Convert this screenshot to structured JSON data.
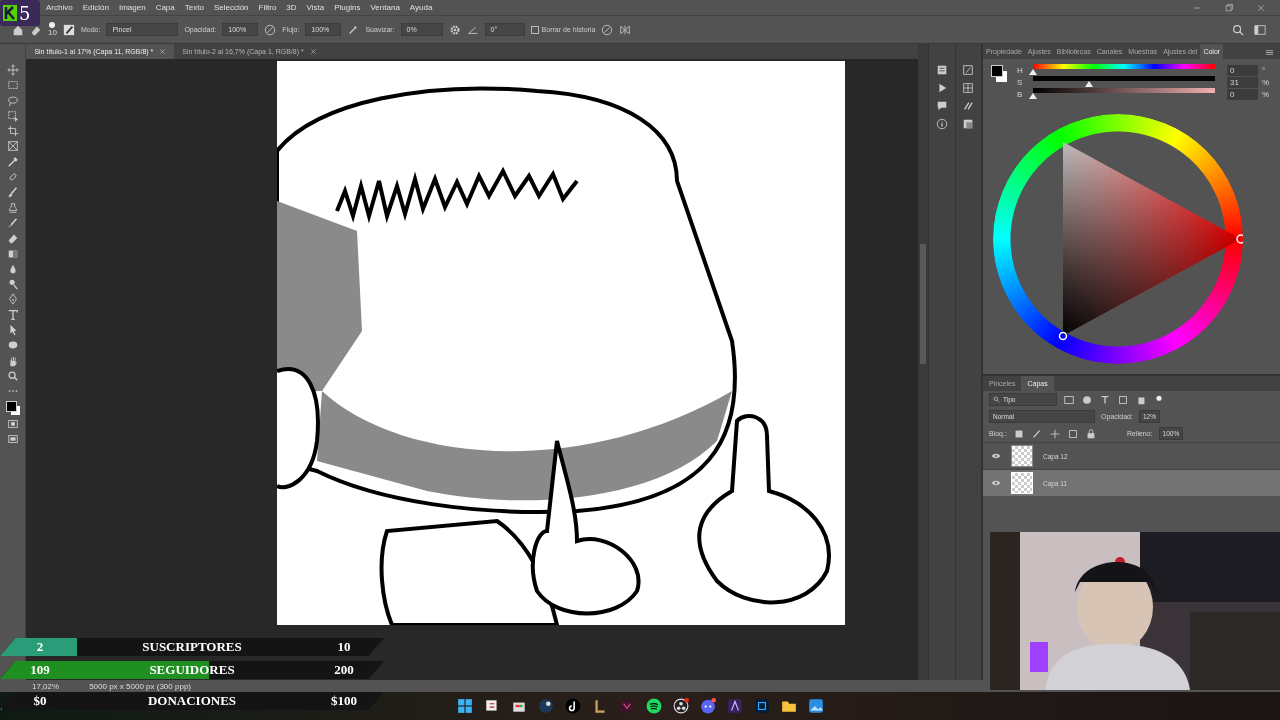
{
  "logo": {
    "text": "5"
  },
  "menu": [
    "Archivo",
    "Edición",
    "Imagen",
    "Capa",
    "Texto",
    "Selección",
    "Filtro",
    "3D",
    "Vista",
    "Plugins",
    "Ventana",
    "Ayuda"
  ],
  "options_bar": {
    "brush_size": "10",
    "mode_label": "Modo:",
    "mode": "Pincel",
    "opacity_label": "Opacidad:",
    "opacity": "100%",
    "flow_label": "Flujo:",
    "flow": "100%",
    "smoothing_label": "Suavizar:",
    "smoothing": "0%",
    "angle": "0°",
    "erase_history": {
      "label": "Borrar de historia",
      "checked": false
    }
  },
  "documents": [
    {
      "title": "Sin título-1 al 17% (Capa 11, RGB/8) *",
      "selected": true
    },
    {
      "title": "Sin título-2 al 16,7% (Capa 1, RGB/8) *",
      "selected": false
    }
  ],
  "color_panel": {
    "tabs": [
      {
        "label": "Propiedade",
        "selected": false
      },
      {
        "label": "Ajustes",
        "selected": false
      },
      {
        "label": "Bibliotecas",
        "selected": false
      },
      {
        "label": "Canales",
        "selected": false
      },
      {
        "label": "Muestras",
        "selected": false
      },
      {
        "label": "Ajustes del",
        "selected": false
      },
      {
        "label": "Color",
        "selected": true
      }
    ],
    "sliders": [
      {
        "kind": "hue",
        "label": "H",
        "level": 0,
        "value": "0",
        "unit": "°"
      },
      {
        "kind": "saturation",
        "label": "S",
        "level": 0.31,
        "value": "31",
        "unit": "%"
      },
      {
        "kind": "brightness",
        "label": "B",
        "level": 0,
        "value": "0",
        "unit": "%"
      }
    ]
  },
  "layers_panel": {
    "tabs": [
      {
        "label": "Pinceles",
        "selected": false
      },
      {
        "label": "Capas",
        "selected": true
      }
    ],
    "filter": "Tipo",
    "blend_mode": "Normal",
    "opacity_label": "Opacidad:",
    "opacity": "12%",
    "lock_label": "Bloq.:",
    "fill_label": "Relleno:",
    "fill": "100%",
    "layers": [
      {
        "name": "Capa 12",
        "visible": true,
        "selected": false
      },
      {
        "name": "Capa 11",
        "visible": true,
        "selected": true
      }
    ]
  },
  "status_bar": {
    "zoom": "17,02%",
    "document_size": "5000 px x 5000 px (300 ppp)"
  },
  "goals": [
    {
      "current": "2",
      "label": "SUSCRIPTORES",
      "target": "10",
      "level": 0.2,
      "color": "#2a9d78"
    },
    {
      "current": "109",
      "label": "SEGUIDORES",
      "target": "200",
      "level": 0.545,
      "color": "#1f8f22"
    },
    {
      "current": "$0",
      "label": "DONACIONES",
      "target": "$100",
      "level": 0
    }
  ]
}
